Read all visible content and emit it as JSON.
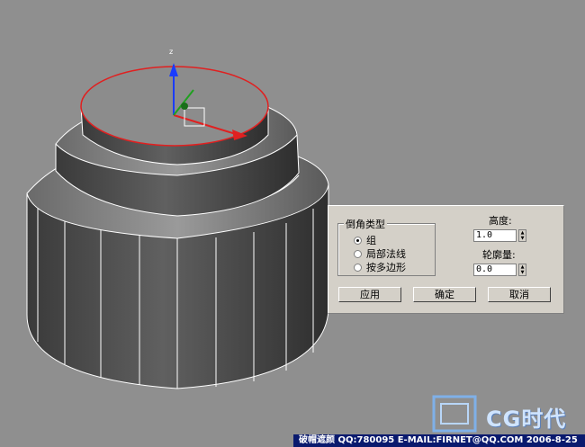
{
  "dialog": {
    "group_title": "倒角类型",
    "options": [
      {
        "label": "组",
        "selected": true
      },
      {
        "label": "局部法线",
        "selected": false
      },
      {
        "label": "按多边形",
        "selected": false
      }
    ],
    "height_label": "高度:",
    "height_value": "1.0",
    "outline_label": "轮廓量:",
    "outline_value": "0.0",
    "apply_label": "应用",
    "ok_label": "确定",
    "cancel_label": "取消"
  },
  "gizmo": {
    "axis_z": "z"
  },
  "watermark": {
    "logo_text": "CG时代",
    "banner_text": "破帽遮颜  QQ:780095  E-MAIL:FIRNET@QQ.COM  2006-8-25"
  },
  "colors": {
    "viewport_bg": "#8f8f8f",
    "wire": "#ffffff",
    "selection": "#e02020",
    "dialog_bg": "#d4d0c8"
  }
}
